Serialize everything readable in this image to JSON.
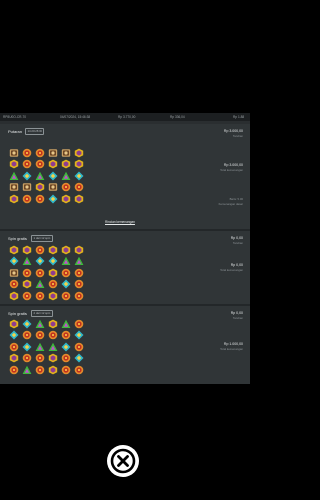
{
  "topbar": {
    "round_id": "RP8U0O-CR-70",
    "datetime": "04/07/2024, 15:46:38",
    "bet": "Rp 3.770,00",
    "balance": "Rp 336,04",
    "extra": "Rp 1.88"
  },
  "rounds": [
    {
      "label": "Putaran",
      "badge": "14:20:28 ID",
      "amount1": "Rp 3.000,00",
      "amount1_sub": "Taruhan",
      "amount2": "Rp 3.000,00",
      "amount2_sub": "Total kemenangan",
      "extra1": "Baris: 5.00",
      "extra2": "Kemenangan dasar",
      "link": "Rincian kemenangan",
      "grid": [
        [
          "mask",
          "ring",
          "ring",
          "mask",
          "mask",
          "hex"
        ],
        [
          "hex",
          "ring",
          "ring",
          "hex",
          "hex",
          "hex"
        ],
        [
          "tri",
          "diamond",
          "tri",
          "diamond",
          "tri",
          "diamond"
        ],
        [
          "mask",
          "mask",
          "hex",
          "mask",
          "ring",
          "ring"
        ],
        [
          "hex",
          "ring",
          "ring",
          "diamond",
          "hex",
          "hex"
        ]
      ]
    },
    {
      "label": "Spin gratis",
      "badge": "1 dari 12 spin",
      "amount1": "Rp 0,00",
      "amount1_sub": "Taruhan",
      "amount2": "Rp 0,00",
      "amount2_sub": "Total kemenangan",
      "grid": [
        [
          "hex",
          "hex",
          "ring",
          "hex",
          "hex",
          "hex"
        ],
        [
          "diamond",
          "tri",
          "diamond",
          "diamond",
          "tri",
          "tri"
        ],
        [
          "mask",
          "ring",
          "ring",
          "hex",
          "ring",
          "ring"
        ],
        [
          "ring",
          "hex",
          "tri",
          "ring",
          "diamond",
          "ring"
        ],
        [
          "hex",
          "ring",
          "ring",
          "hex",
          "ring",
          "ring"
        ]
      ]
    },
    {
      "label": "Spin gratis",
      "badge": "2 dari 12 spin",
      "amount1": "Rp 0,00",
      "amount1_sub": "Taruhan",
      "amount2": "Rp 1.000,00",
      "amount2_sub": "Total kemenangan",
      "grid": [
        [
          "hex",
          "diamond",
          "tri",
          "hex",
          "tri",
          "ring"
        ],
        [
          "diamond",
          "ring",
          "ring",
          "ring",
          "ring",
          "diamond"
        ],
        [
          "ring",
          "diamond",
          "tri",
          "tri",
          "diamond",
          "ring"
        ],
        [
          "hex",
          "ring",
          "ring",
          "hex",
          "ring",
          "diamond"
        ],
        [
          "ring",
          "tri",
          "ring",
          "hex",
          "ring",
          "ring"
        ]
      ]
    }
  ],
  "icons": {
    "close": "close-icon"
  }
}
